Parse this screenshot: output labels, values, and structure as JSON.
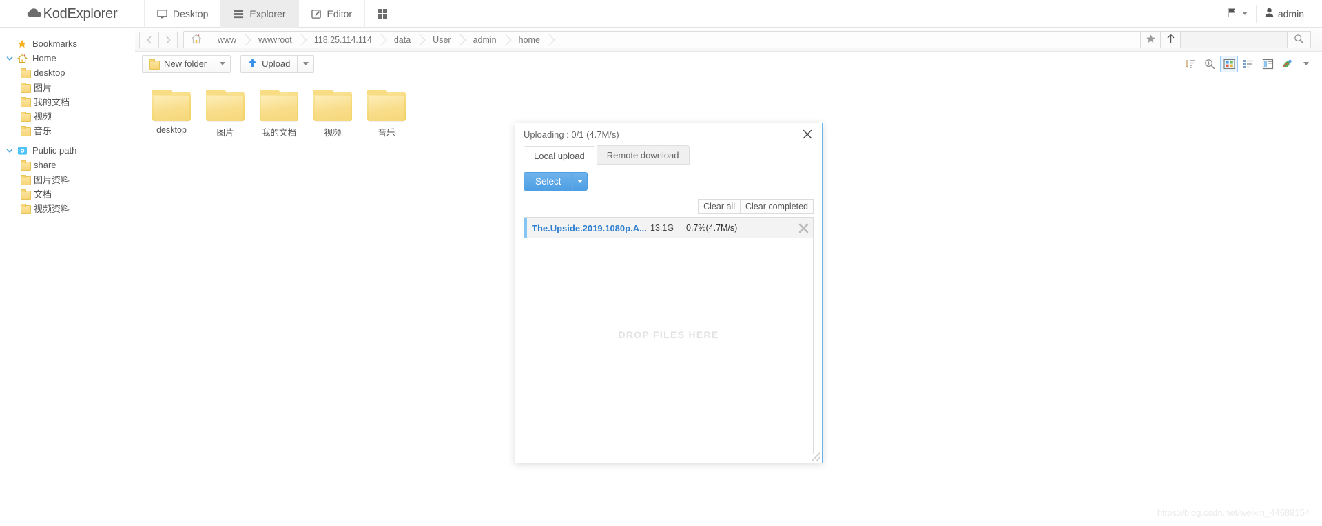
{
  "app": {
    "brand": "KodExplorer",
    "tabs": [
      {
        "label": "Desktop",
        "icon": "monitor-icon",
        "active": false
      },
      {
        "label": "Explorer",
        "icon": "explorer-icon",
        "active": true
      },
      {
        "label": "Editor",
        "icon": "edit-icon",
        "active": false
      },
      {
        "label": "",
        "icon": "apps-grid-icon",
        "active": false
      }
    ],
    "header_right": {
      "language_icon": "flag-icon",
      "language_caret": "chevron-down-icon",
      "user_icon": "user-icon",
      "user_name": "admin"
    }
  },
  "sidebar": {
    "items": [
      {
        "label": "Bookmarks",
        "icon": "star-icon",
        "level": 1,
        "arrow": ""
      },
      {
        "label": "Home",
        "icon": "home-icon",
        "level": 1,
        "arrow": "⌄"
      },
      {
        "label": "desktop",
        "icon": "folder-icon",
        "level": 2,
        "arrow": ""
      },
      {
        "label": "图片",
        "icon": "folder-icon",
        "level": 2,
        "arrow": ""
      },
      {
        "label": "我的文档",
        "icon": "folder-icon",
        "level": 2,
        "arrow": ""
      },
      {
        "label": "视频",
        "icon": "folder-icon",
        "level": 2,
        "arrow": ""
      },
      {
        "label": "音乐",
        "icon": "folder-icon",
        "level": 2,
        "arrow": ""
      },
      {
        "label": "Public path",
        "icon": "public-path-icon",
        "level": 1,
        "arrow": "⌄"
      },
      {
        "label": "share",
        "icon": "folder-icon",
        "level": 2,
        "arrow": ""
      },
      {
        "label": "图片资料",
        "icon": "folder-icon",
        "level": 2,
        "arrow": ""
      },
      {
        "label": "文档",
        "icon": "folder-icon",
        "level": 2,
        "arrow": ""
      },
      {
        "label": "视频资料",
        "icon": "folder-icon",
        "level": 2,
        "arrow": ""
      }
    ]
  },
  "pathbar": {
    "back_icon": "chevron-left-icon",
    "forward_icon": "chevron-right-icon",
    "home_icon": "home-icon",
    "crumbs": [
      "www",
      "wwwroot",
      "118.25.114.114",
      "data",
      "User",
      "admin",
      "home"
    ],
    "favorite_icon": "star-icon",
    "up_icon": "arrow-up-icon",
    "search_value": "",
    "search_placeholder": "",
    "search_icon": "search-icon"
  },
  "toolbar": {
    "new_folder_label": "New folder",
    "new_folder_icon": "folder-icon",
    "upload_label": "Upload",
    "upload_icon": "arrow-up-blue-icon",
    "dropdown_icon": "chevron-down-icon",
    "right_icons": [
      {
        "name": "sort-icon",
        "active": false
      },
      {
        "name": "zoom-icon",
        "active": false
      },
      {
        "name": "grid-view-icon",
        "active": true
      },
      {
        "name": "list-view-icon",
        "active": false
      },
      {
        "name": "split-view-icon",
        "active": false
      },
      {
        "name": "theme-icon",
        "active": false
      }
    ]
  },
  "files": [
    {
      "name": "desktop",
      "type": "folder"
    },
    {
      "name": "图片",
      "type": "folder"
    },
    {
      "name": "我的文档",
      "type": "folder"
    },
    {
      "name": "视频",
      "type": "folder"
    },
    {
      "name": "音乐",
      "type": "folder"
    }
  ],
  "upload_dialog": {
    "title": "Uploading : 0/1 (4.7M/s)",
    "close_icon": "close-icon",
    "tabs": [
      {
        "label": "Local upload",
        "active": true
      },
      {
        "label": "Remote download",
        "active": false
      }
    ],
    "select_label": "Select",
    "select_caret_icon": "chevron-down-icon",
    "clear_all_label": "Clear all",
    "clear_completed_label": "Clear completed",
    "rows": [
      {
        "name": "The.Upside.2019.1080p.A...",
        "size": "13.1G",
        "progress": "0.7%(4.7M/s)",
        "remove_icon": "close-icon"
      }
    ],
    "drop_hint": "DROP FILES HERE",
    "resize_icon": "resize-grip-icon"
  },
  "watermark": "https://blog.csdn.net/weixin_44689154",
  "colors": {
    "accent": "#4e9fe3",
    "folder": "#f6d87a",
    "dialog_border": "#6cb3e8",
    "link": "#2f7fd1"
  }
}
